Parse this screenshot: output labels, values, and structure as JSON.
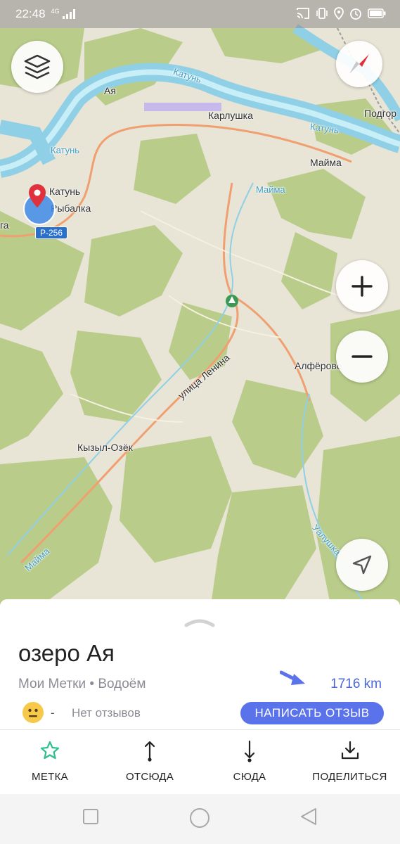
{
  "status_bar": {
    "time": "22:48",
    "signal_text": "4G"
  },
  "map": {
    "labels": {
      "aya": "Ая",
      "karlushka": "Карлушка",
      "podgor": "Подгор",
      "katun_river_top": "Катунь",
      "katun_river_right": "Катунь",
      "katun_river_left": "Катунь",
      "mayma_town": "Майма",
      "mayma_river_top": "Майма",
      "katun_village": "Катунь",
      "rybalka": "Рыбалка",
      "lenina_street": "улица Ленина",
      "alferovo": "Алфёрово",
      "kyzyl_ozek": "Кызыл-Озёк",
      "mayma_river_bottom": "Майма",
      "ualushka": "Уалушка",
      "edge_ga": "га"
    },
    "road_badge": "Р-256"
  },
  "place": {
    "title": "озеро Ая",
    "subtitle": "Мои Метки • Водоём",
    "distance": "1716 km",
    "rating_dash": "-",
    "reviews": "Нет отзывов",
    "write_review": "НАПИСАТЬ ОТЗЫВ"
  },
  "actions": {
    "mark": "МЕТКА",
    "from_here": "ОТСЮДА",
    "to_here": "СЮДА",
    "share": "ПОДЕЛИТЬСЯ"
  },
  "colors": {
    "accent": "#5b73ea",
    "distance_blue": "#4a68d8",
    "mark_green": "#2fbf8f",
    "water": "#8fd0e6",
    "forest": "#b9cc8a",
    "land": "#e8e4d6"
  }
}
